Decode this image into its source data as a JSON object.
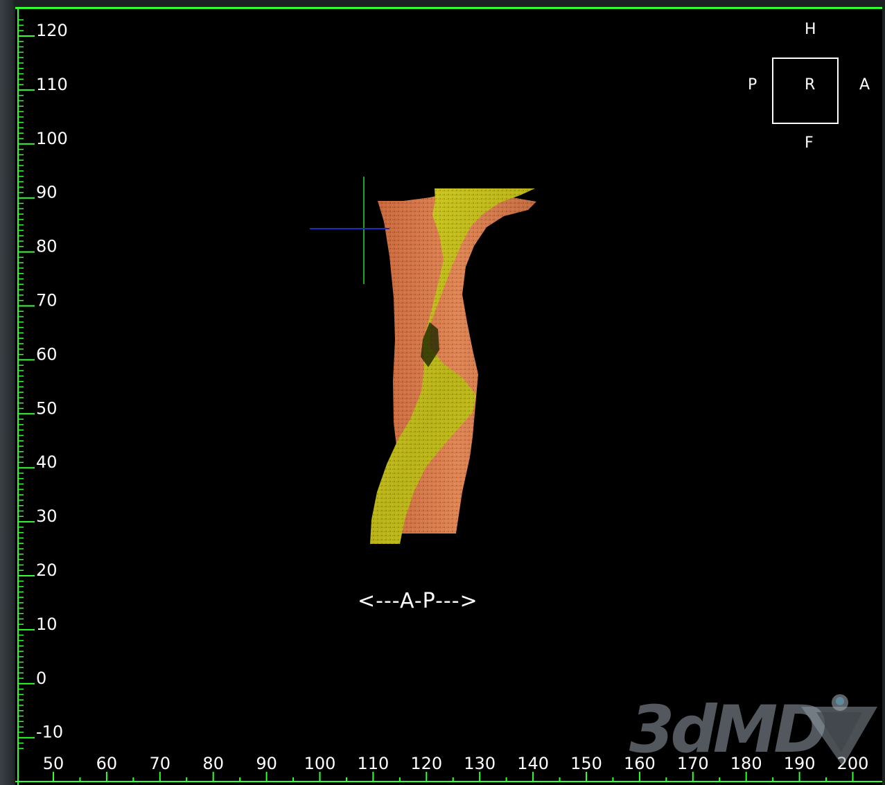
{
  "viewer": {
    "axis_color": "#33ff33",
    "background": "#000000",
    "y_axis": {
      "min": -10,
      "max": 120,
      "major_step": 10,
      "tick_labels": [
        "120",
        "110",
        "100",
        "90",
        "80",
        "70",
        "60",
        "50",
        "40",
        "30",
        "20",
        "10",
        "0",
        "-10"
      ]
    },
    "x_axis": {
      "min": 50,
      "max": 200,
      "major_step": 10,
      "tick_labels": [
        "50",
        "60",
        "70",
        "80",
        "90",
        "100",
        "110",
        "120",
        "130",
        "140",
        "150",
        "160",
        "170",
        "180",
        "190",
        "200"
      ]
    }
  },
  "orientation": {
    "top": "H",
    "left": "P",
    "center": "R",
    "right": "A",
    "bottom": "F"
  },
  "view_axis_label": "<---A-P--->",
  "logo": {
    "text": "3dMD",
    "icon": "3dmd-v-logo-icon"
  },
  "crosshair": {
    "vertical_color": "#1fa21f",
    "horizontal_color": "#1a2fb8"
  },
  "regions": {
    "orange_color": "#d9794a",
    "yellow_color": "#c9c21c"
  }
}
